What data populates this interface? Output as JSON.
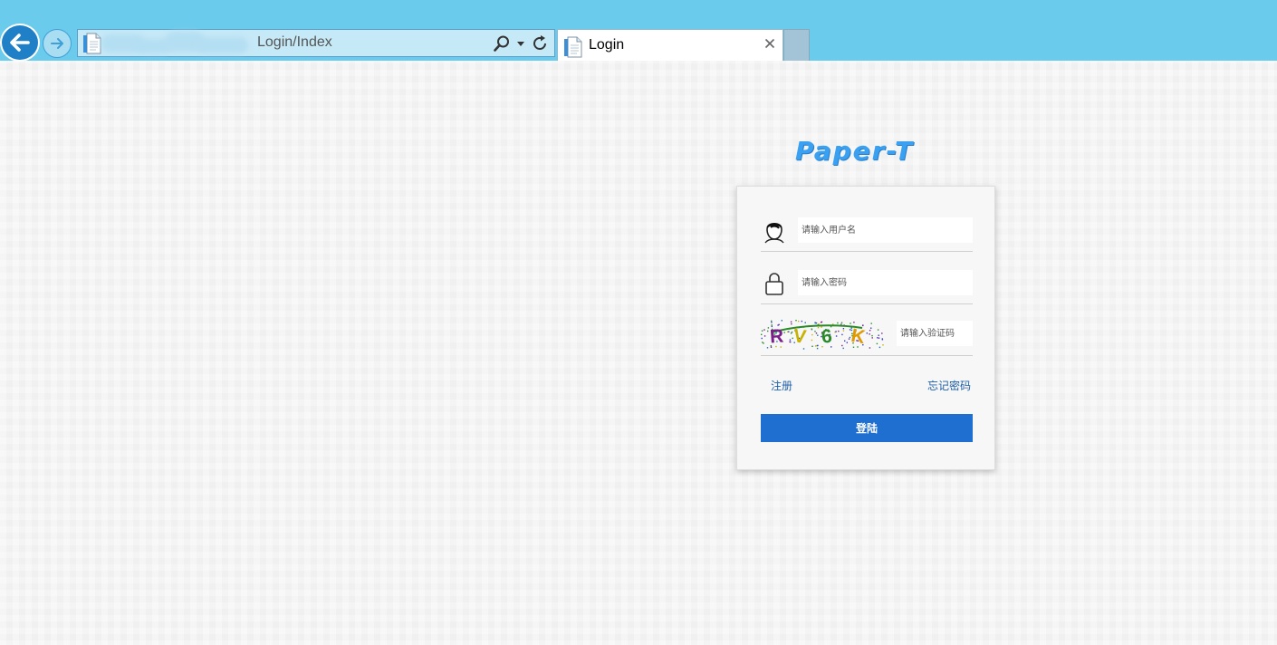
{
  "browser": {
    "address_text": "Login/Index",
    "tab_title": "Login",
    "chrome_color": "#6acbec"
  },
  "icons": {
    "back": "back-arrow-icon",
    "forward": "forward-arrow-icon",
    "page": "page-icon",
    "search": "search-icon",
    "dropdown": "chevron-down-icon",
    "refresh": "refresh-icon",
    "close": "close-icon",
    "user": "user-avatar-icon",
    "lock": "lock-icon"
  },
  "logo": {
    "text": "Paper-T",
    "color": "#3aa0f2"
  },
  "login": {
    "username_placeholder": "请输入用户名",
    "password_placeholder": "请输入密码",
    "captcha_placeholder": "请输入验证码",
    "register_label": "注册",
    "forgot_label": "忘记密码",
    "submit_label": "登陆",
    "button_color": "#1f6fd0",
    "link_color": "#1f5fa8"
  },
  "captcha": {
    "text": "RV6K",
    "chars": [
      {
        "ch": "R",
        "color": "#7a1f8a"
      },
      {
        "ch": "V",
        "color": "#c8b400"
      },
      {
        "ch": "6",
        "color": "#2a8a2a"
      },
      {
        "ch": "K",
        "color": "#e09a00"
      }
    ]
  }
}
